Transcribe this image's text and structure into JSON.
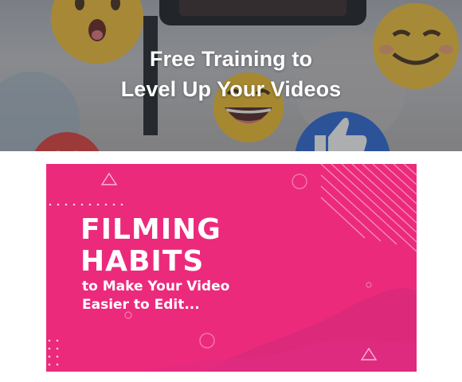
{
  "hero": {
    "title_line1": "Free Training to",
    "title_line2": "Level Up Your Videos",
    "text_color": "#ffffff"
  },
  "card": {
    "title_line1": "FILMING",
    "title_line2": "HABITS",
    "subtitle_line1": "to Make Your Video",
    "subtitle_line2": "Easier to Edit...",
    "background_color": "#ec2a7c",
    "text_color": "#ffffff"
  }
}
